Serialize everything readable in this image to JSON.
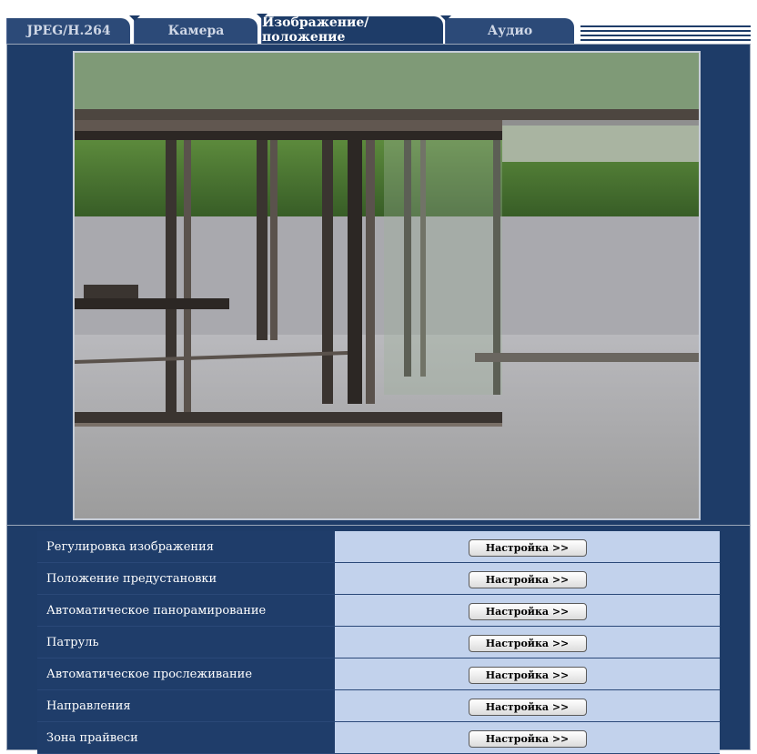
{
  "tabs": [
    {
      "label": "JPEG/H.264",
      "active": false
    },
    {
      "label": "Камера",
      "active": false
    },
    {
      "label": "Изображение/положение",
      "active": true
    },
    {
      "label": "Аудио",
      "active": false
    }
  ],
  "preview": {
    "description_icon": "camera-live-image"
  },
  "settings": [
    {
      "label": "Регулировка изображения",
      "button": "Настройка >>"
    },
    {
      "label": "Положение предустановки",
      "button": "Настройка >>"
    },
    {
      "label": "Автоматическое панорамирование",
      "button": "Настройка >>"
    },
    {
      "label": "Патруль",
      "button": "Настройка >>"
    },
    {
      "label": "Автоматическое прослеживание",
      "button": "Настройка >>"
    },
    {
      "label": "Направления",
      "button": "Настройка >>"
    },
    {
      "label": "Зона прайвеси",
      "button": "Настройка >>"
    }
  ],
  "colors": {
    "panel": "#1e3c68",
    "row_action": "#c2d2ec"
  }
}
